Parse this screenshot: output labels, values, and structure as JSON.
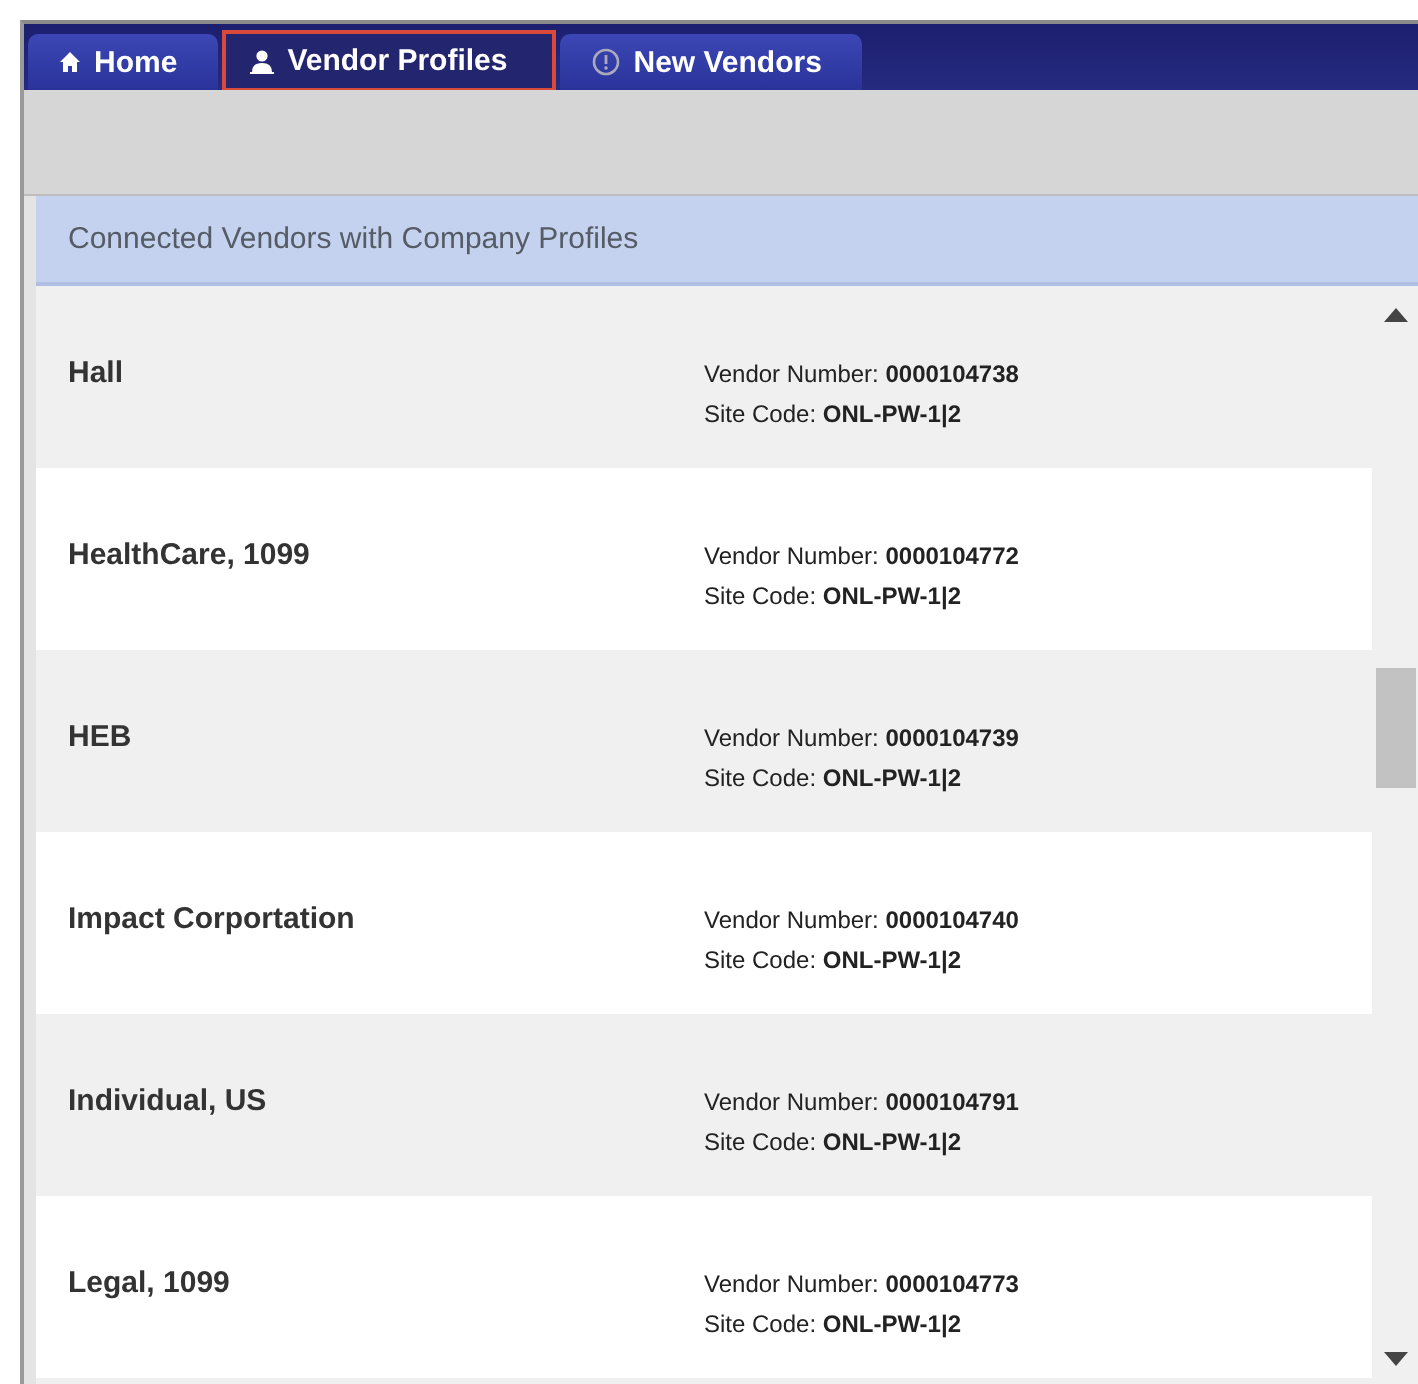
{
  "tabs": [
    {
      "label": "Home",
      "kind": "home",
      "selected": false
    },
    {
      "label": "Vendor Profiles",
      "kind": "profiles",
      "selected": true
    },
    {
      "label": "New Vendors",
      "kind": "notice",
      "selected": false
    }
  ],
  "section": {
    "title": "Connected Vendors with Company Profiles"
  },
  "vendors": [
    {
      "name": "Hall",
      "vendor_number": "Vendor Number: **0000104738**",
      "site_code": "Site Code: **ONL-PW-1|2**"
    },
    {
      "name": "HealthCare, 1099",
      "vendor_number": "Vendor Number: **0000104772**",
      "site_code": "Site Code: **ONL-PW-1|2**"
    },
    {
      "name": "HEB",
      "vendor_number": "Vendor Number: **0000104739**",
      "site_code": "Site Code: **ONL-PW-1|2**"
    },
    {
      "name": "Impact Corportation",
      "vendor_number": "Vendor Number: **0000104740**",
      "site_code": "Site Code: **ONL-PW-1|2**"
    },
    {
      "name": "Individual, US",
      "vendor_number": "Vendor Number: **0000104791**",
      "site_code": "Site Code: **ONL-PW-1|2**"
    },
    {
      "name": "Legal, 1099",
      "vendor_number": "Vendor Number: **0000104773**",
      "site_code": "Site Code: **ONL-PW-1|2**"
    }
  ]
}
